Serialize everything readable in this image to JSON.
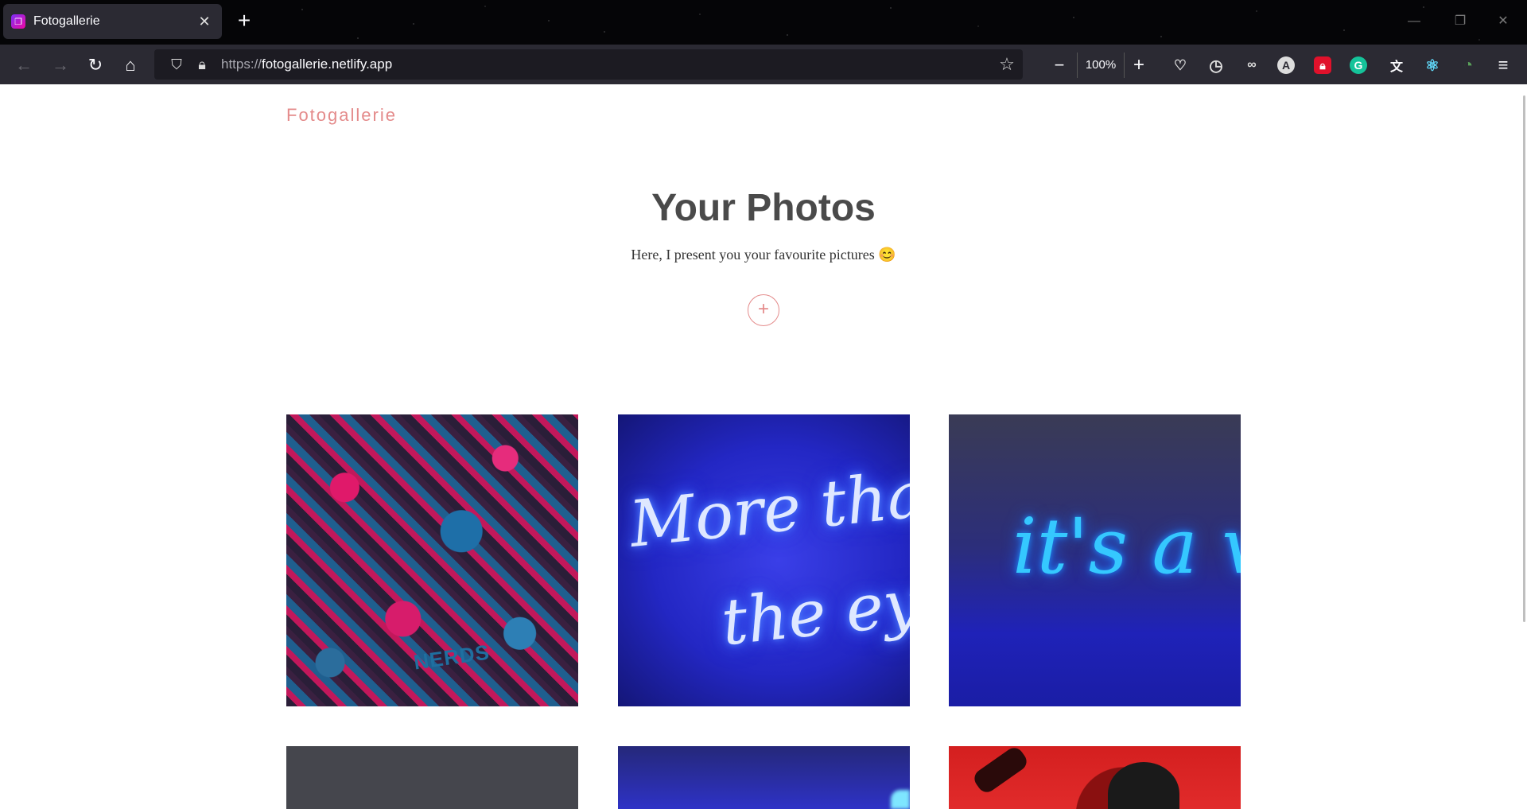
{
  "browser": {
    "tab_title": "Fotogallerie",
    "tab_favicon": "fotogallerie-favicon",
    "url_protocol": "https://",
    "url_host": "fotogallerie.netlify.app",
    "zoom_level": "100%",
    "extensions": [
      "pocket-icon",
      "history-icon",
      "incognito-icon",
      "account-A-icon",
      "lock-extension-icon",
      "grammarly-icon",
      "translate-icon",
      "react-devtools-icon",
      "clock-extension-icon"
    ],
    "accent_color": "#2b2a33"
  },
  "page": {
    "brand": "Fotogallerie",
    "title": "Your Photos",
    "subtitle": "Here, I present you your favourite pictures 😊",
    "add_button_label": "+",
    "accent_color": "#e48b8b",
    "photos": [
      {
        "alt": "NERDS"
      },
      {
        "alt": "More than the eye"
      },
      {
        "alt": "it's a vi"
      },
      {
        "alt": ""
      },
      {
        "alt": ""
      },
      {
        "alt": ""
      }
    ]
  }
}
